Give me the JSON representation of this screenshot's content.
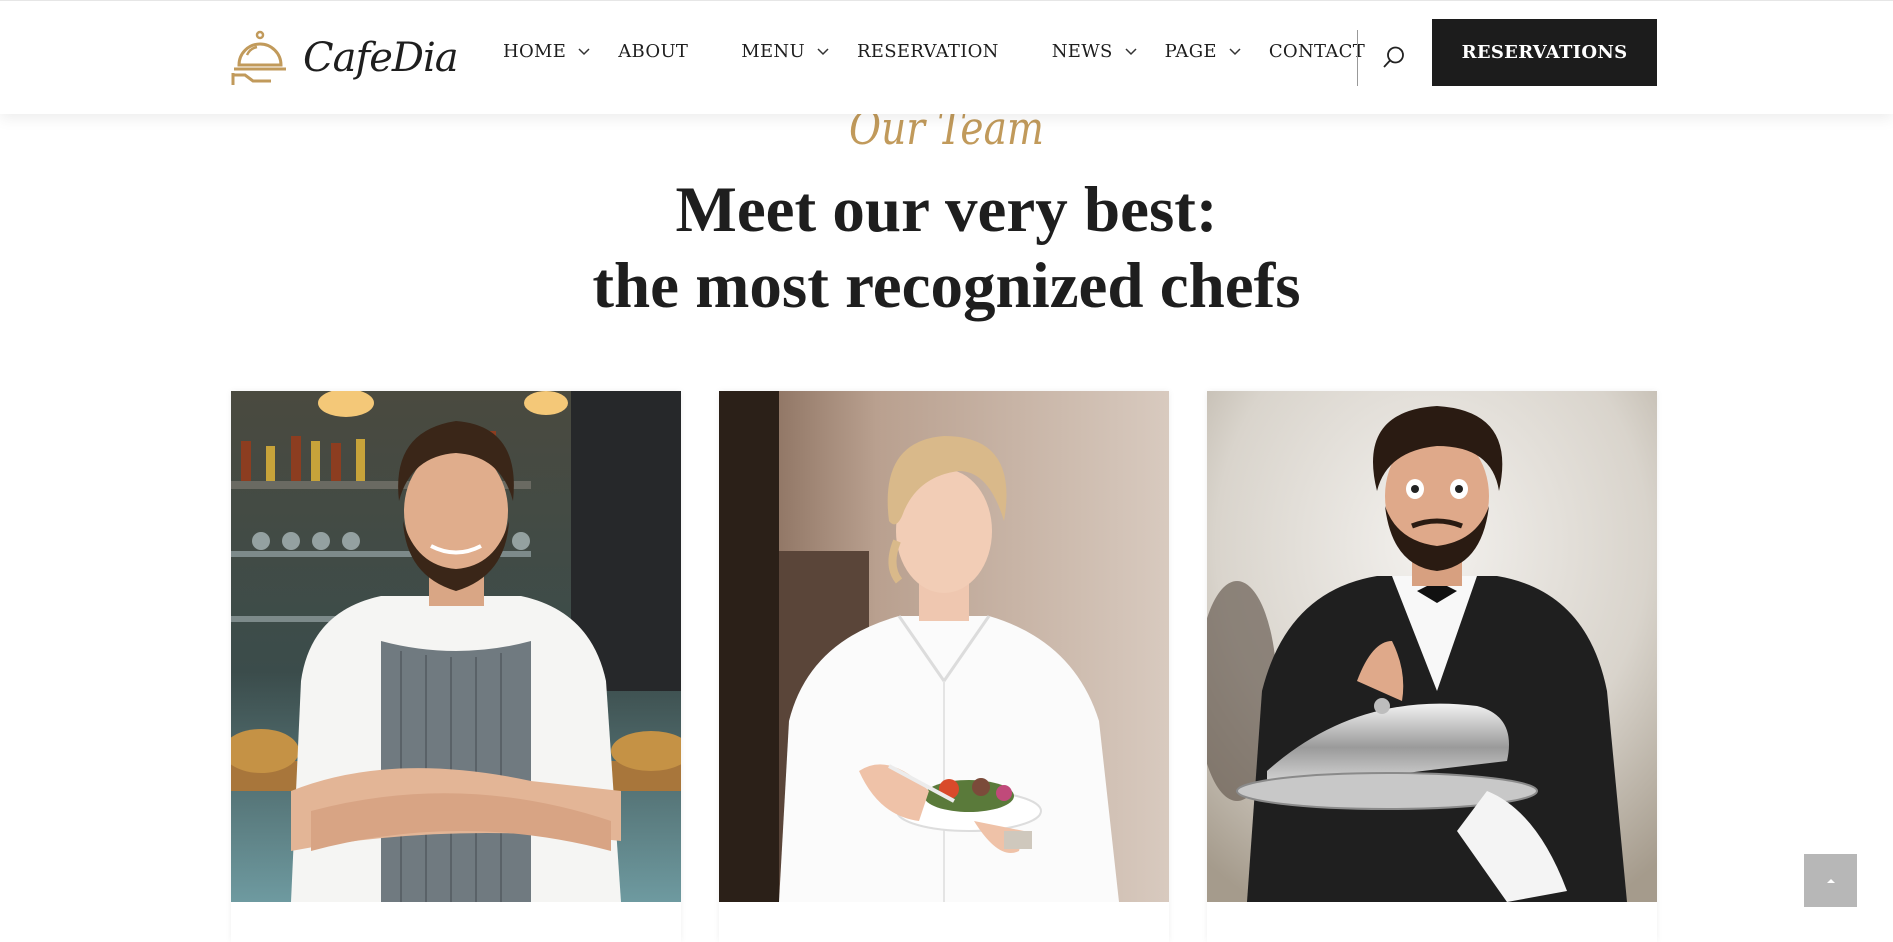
{
  "header": {
    "logo_text": "CafeDia",
    "nav": [
      {
        "label": "HOME",
        "dropdown": true
      },
      {
        "label": "ABOUT",
        "dropdown": false
      },
      {
        "label": "MENU",
        "dropdown": true
      },
      {
        "label": "RESERVATION",
        "dropdown": false
      },
      {
        "label": "NEWS",
        "dropdown": true
      },
      {
        "label": "PAGE",
        "dropdown": true
      },
      {
        "label": "CONTACT",
        "dropdown": false
      }
    ],
    "cta_label": "RESERVATIONS",
    "search_icon": "search-icon"
  },
  "section": {
    "subtitle": "Our Team",
    "title_line1": "Meet our very best:",
    "title_line2": "the most recognized chefs"
  },
  "team": [
    {
      "photo": "barista-with-apron-photo"
    },
    {
      "photo": "chef-with-plate-photo"
    },
    {
      "photo": "waiter-with-cloche-photo"
    }
  ],
  "colors": {
    "accent": "#c19a5b",
    "dark": "#1c1c1c",
    "to_top_bg": "#b7b7b7"
  }
}
